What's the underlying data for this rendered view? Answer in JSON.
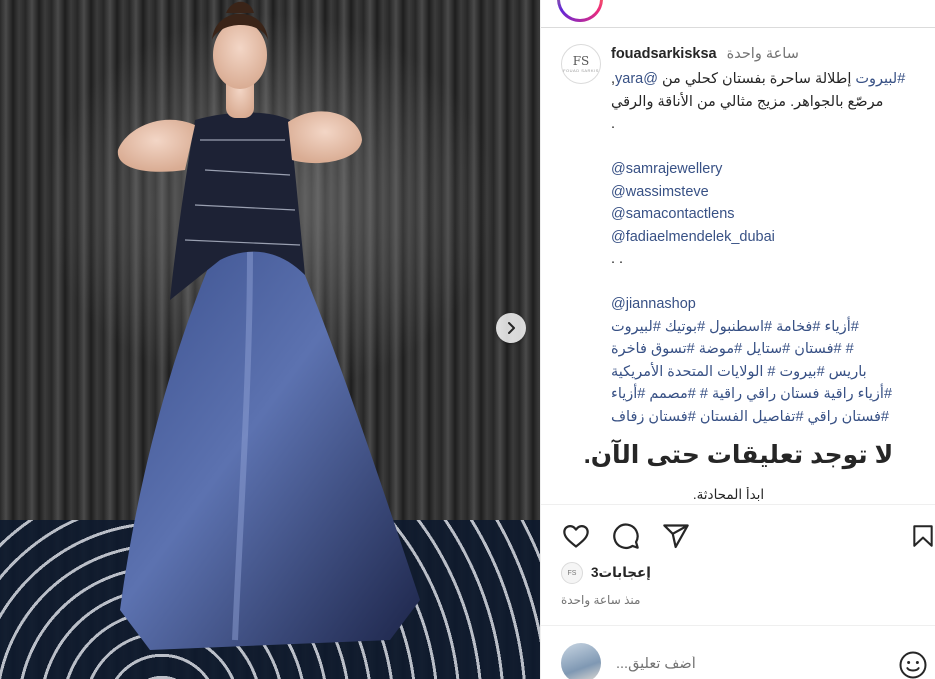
{
  "post": {
    "username": "fouadsarkisksa",
    "time_ago": "ساعة واحدة",
    "avatar_mono": "FS",
    "avatar_tagline": "FOUAD SARKIS"
  },
  "caption": {
    "line1_link_mention": "@yara",
    "line1_text": " إطلالة ساحرة بفستان كحلي من",
    "line1_hash": "#",
    "line1_tag": "لبيروت",
    "line1_end": ",",
    "line2": "مرصّع بالجواهر. مزيج مثالي من الأناقة والرقي",
    "line3": ".",
    "mentions": [
      "@samrajewellery",
      "@wassimsteve",
      "@samacontactlens",
      "@fadiaelmendelek_dubai"
    ],
    "dots": ". .",
    "shop_mention": "@jiannashop",
    "hashtag_lines": [
      "#أزياء #فخامة #اسطنبول #بوتيك #لبيروت",
      "# #فستان #ستايل #موضة #تسوق فاخرة",
      "باريس #بيروت # الولايات المتحدة الأمريكية",
      "#أزياء راقية فستان راقي راقية # #مصمم #أزياء",
      "#فستان راقي #تفاصيل الفستان #فستان زفاف"
    ]
  },
  "comments": {
    "empty_title": "لا توجد تعليقات حتى الآن.",
    "start_conversation": "ابدأ المحادثة."
  },
  "actions": {
    "like_icon": "heart-icon",
    "comment_icon": "comment-icon",
    "share_icon": "paper-plane-icon",
    "save_icon": "bookmark-icon"
  },
  "likes": {
    "label": "إعجابات3",
    "avatar_text": "FS"
  },
  "post_age": "منذ ساعة واحدة",
  "comment_box": {
    "placeholder": "أضف تعليق..."
  },
  "colors": {
    "link": "#385185",
    "text": "#262626",
    "muted": "#737373",
    "divider": "#dbdbdb"
  }
}
